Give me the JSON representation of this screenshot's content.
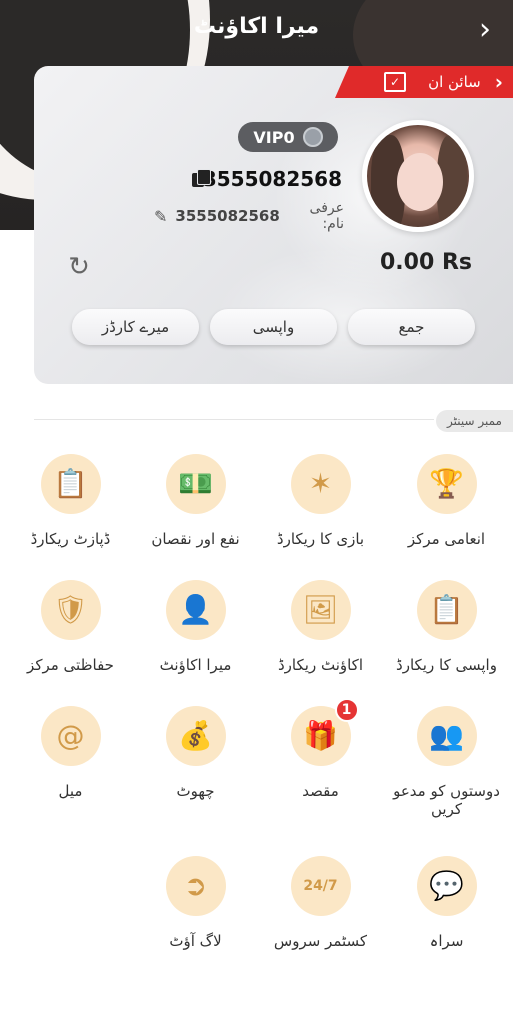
{
  "header": {
    "title": "میرا اکاؤنٹ",
    "back_icon": "chevron-right-icon"
  },
  "card": {
    "signin_label": "سائن ان",
    "vip_label": "VIP0",
    "uid": "3555082568",
    "nickname_label": "عرفی نام:",
    "nickname_value": "3555082568",
    "balance": "0.00 Rs",
    "buttons": {
      "deposit": "جمع",
      "withdraw": "واپسی",
      "my_cards": "میرے کارڈز"
    }
  },
  "member_center": {
    "title": "ممبر سینٹر",
    "items": [
      {
        "label": "انعامی مرکز",
        "icon": "trophy-icon"
      },
      {
        "label": "بازی کا ریکارڈ",
        "icon": "game-record-icon"
      },
      {
        "label": "نفع اور نقصان",
        "icon": "profit-loss-icon"
      },
      {
        "label": "ڈپازٹ ریکارڈ",
        "icon": "deposit-record-icon"
      },
      {
        "label": "واپسی کا ریکارڈ",
        "icon": "withdraw-record-icon"
      },
      {
        "label": "اکاؤنٹ ریکارڈ",
        "icon": "account-record-icon"
      },
      {
        "label": "میرا اکاؤنٹ",
        "icon": "user-icon"
      },
      {
        "label": "حفاظتی مرکز",
        "icon": "shield-icon"
      },
      {
        "label": "دوستوں کو مدعو کریں",
        "icon": "invite-friend-icon"
      },
      {
        "label": "مقصد",
        "icon": "gift-icon",
        "badge": "1"
      },
      {
        "label": "چھوٹ",
        "icon": "coins-icon"
      },
      {
        "label": "میل",
        "icon": "mail-at-icon"
      },
      {
        "label": "سراہ",
        "icon": "feedback-icon"
      },
      {
        "label": "کسٹمر سروس",
        "icon": "customer-service-icon"
      },
      {
        "label": "لاگ آؤٹ",
        "icon": "logout-icon"
      }
    ]
  },
  "colors": {
    "header_bg": "#2c2a29",
    "accent_red": "#e02a2a",
    "icon_bg": "#fbe7c6",
    "icon_fg": "#d19a49"
  }
}
